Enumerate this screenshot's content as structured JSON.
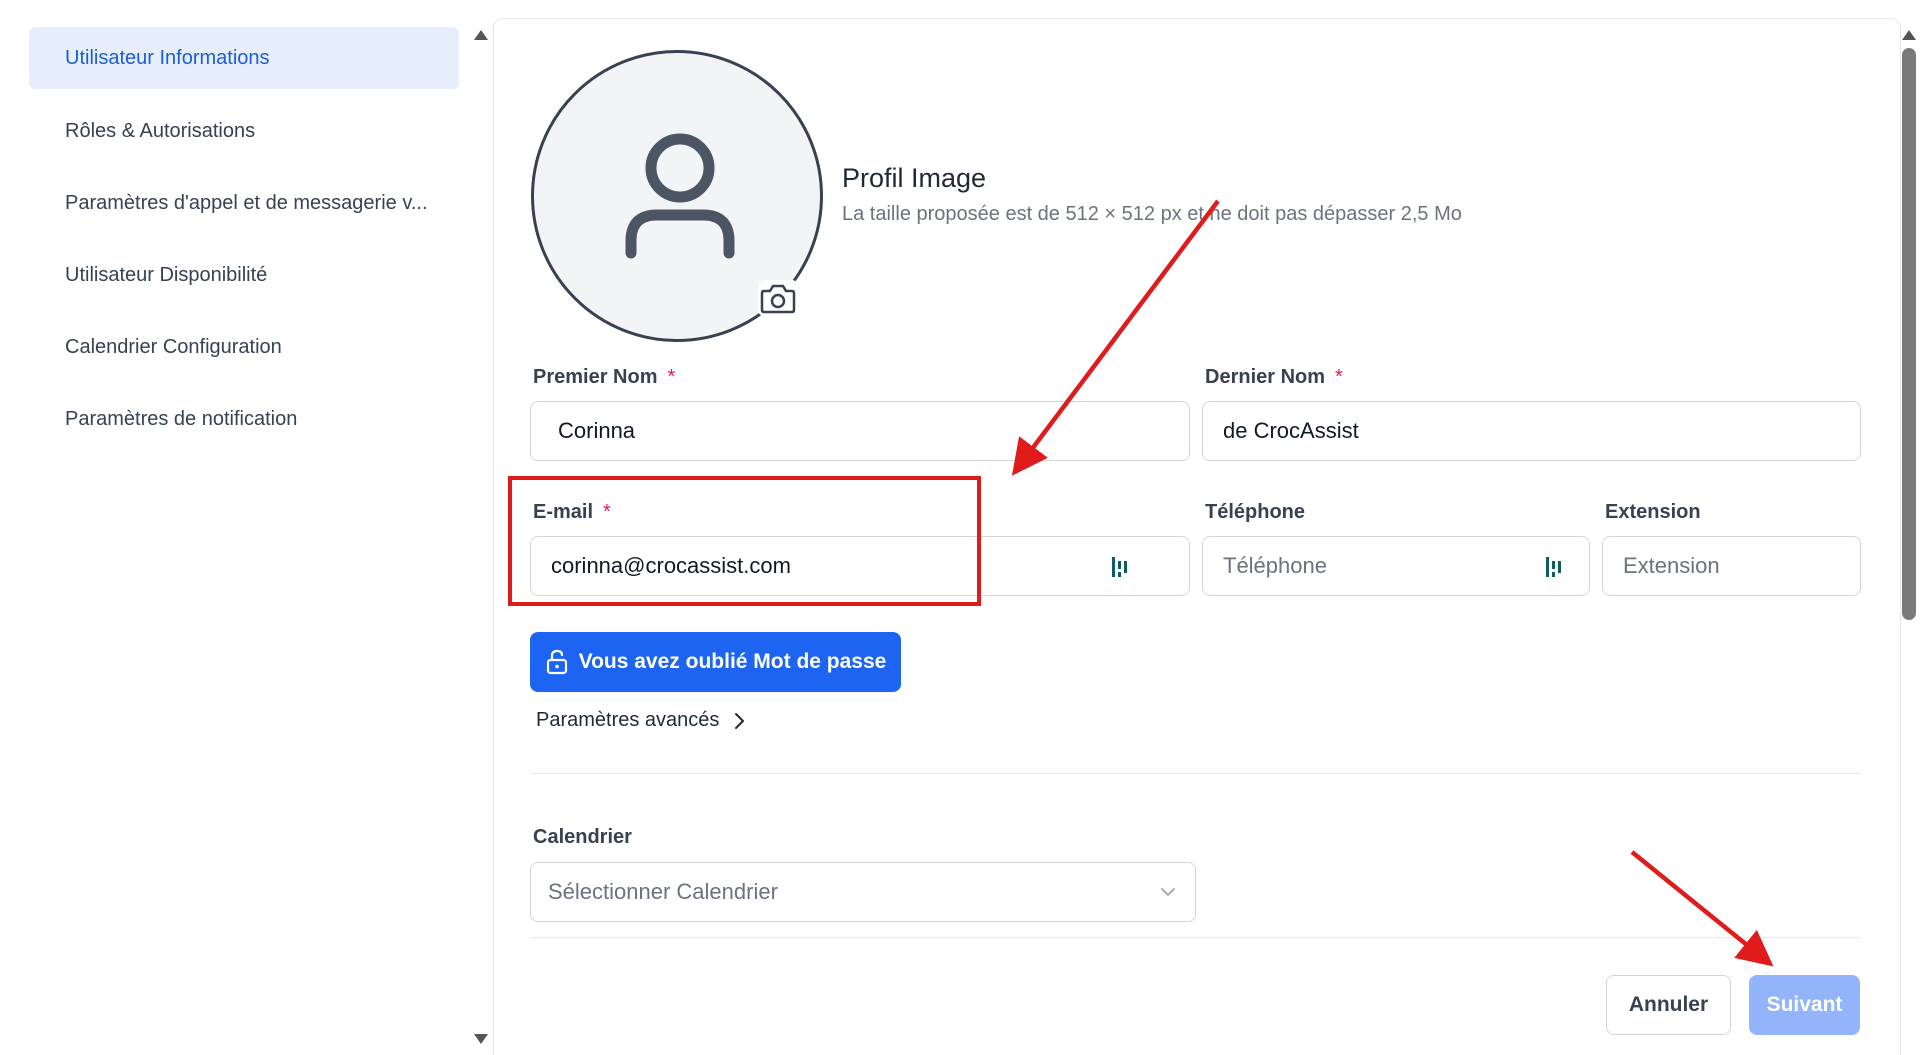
{
  "sidebar": {
    "items": [
      {
        "label": "Utilisateur Informations",
        "active": true
      },
      {
        "label": "Rôles & Autorisations"
      },
      {
        "label": "Paramètres d'appel et de messagerie v..."
      },
      {
        "label": "Utilisateur Disponibilité"
      },
      {
        "label": "Calendrier Configuration"
      },
      {
        "label": "Paramètres de notification"
      }
    ]
  },
  "profile": {
    "title": "Profil Image",
    "subtitle": "La taille proposée est de 512 × 512 px et ne doit pas dépasser 2,5 Mo"
  },
  "form": {
    "first_name": {
      "label": "Premier Nom",
      "required": "*",
      "value": "Corinna"
    },
    "last_name": {
      "label": "Dernier Nom",
      "required": "*",
      "value": "de CrocAssist"
    },
    "email": {
      "label": "E-mail",
      "required": "*",
      "value": "corinna@crocassist.com"
    },
    "phone": {
      "label": "Téléphone",
      "placeholder": "Téléphone"
    },
    "extension": {
      "label": "Extension",
      "placeholder": "Extension"
    },
    "forgot_password": "Vous avez oublié Mot de passe",
    "advanced": "Paramètres avancés",
    "calendar": {
      "label": "Calendrier",
      "placeholder": "Sélectionner Calendrier"
    }
  },
  "footer": {
    "cancel": "Annuler",
    "next": "Suivant"
  },
  "colors": {
    "primary": "#1d64f2",
    "primary_disabled": "#93b4fa",
    "annotation": "#e01b1b"
  },
  "icons": [
    "user-icon",
    "camera-icon",
    "lock-icon",
    "chevron-right-icon",
    "chevron-down-icon",
    "autofill-icon"
  ]
}
